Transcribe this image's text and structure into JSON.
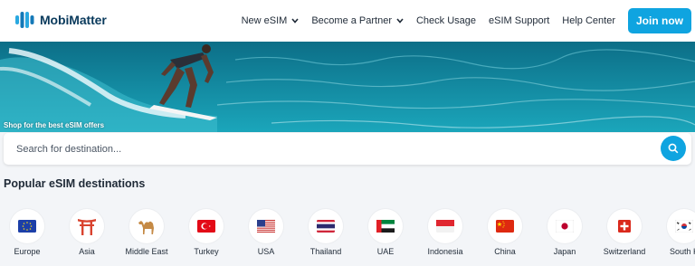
{
  "header": {
    "brand": "MobiMatter",
    "nav": [
      {
        "label": "New eSIM",
        "dropdown": true
      },
      {
        "label": "Become a Partner",
        "dropdown": true
      },
      {
        "label": "Check Usage",
        "dropdown": false
      },
      {
        "label": "eSIM Support",
        "dropdown": false
      },
      {
        "label": "Help Center",
        "dropdown": false
      }
    ],
    "join_label": "Join now"
  },
  "hero": {
    "tagline": "Shop for the best eSIM offers"
  },
  "search": {
    "placeholder": "Search for destination...",
    "value": ""
  },
  "popular": {
    "title": "Popular eSIM destinations",
    "destinations": [
      {
        "name": "Europe",
        "icon": "eu-flag-icon"
      },
      {
        "name": "Asia",
        "icon": "torii-gate-icon"
      },
      {
        "name": "Middle East",
        "icon": "camel-icon"
      },
      {
        "name": "Turkey",
        "icon": "turkey-flag-icon"
      },
      {
        "name": "USA",
        "icon": "usa-flag-icon"
      },
      {
        "name": "Thailand",
        "icon": "thailand-flag-icon"
      },
      {
        "name": "UAE",
        "icon": "uae-flag-icon"
      },
      {
        "name": "Indonesia",
        "icon": "indonesia-flag-icon"
      },
      {
        "name": "China",
        "icon": "china-flag-icon"
      },
      {
        "name": "Japan",
        "icon": "japan-flag-icon"
      },
      {
        "name": "Switzerland",
        "icon": "switzerland-flag-icon"
      },
      {
        "name": "South K",
        "icon": "south-korea-flag-icon"
      }
    ]
  },
  "colors": {
    "accent": "#0fa4e0",
    "brand_text": "#0a3a5c"
  }
}
